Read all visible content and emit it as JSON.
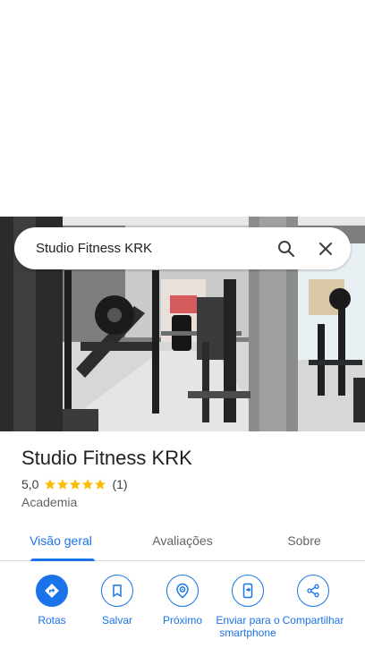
{
  "search": {
    "value": "Studio Fitness KRK",
    "search_icon": "search-icon",
    "close_icon": "close-icon"
  },
  "hero": {
    "image": "gym interior photo with weight machines"
  },
  "place": {
    "title": "Studio Fitness KRK",
    "rating": "5,0",
    "stars": 5,
    "review_count": "(1)",
    "category": "Academia",
    "star_color": "#fbbc04"
  },
  "tabs": [
    {
      "label": "Visão geral",
      "active": true
    },
    {
      "label": "Avaliações",
      "active": false
    },
    {
      "label": "Sobre",
      "active": false
    }
  ],
  "actions": [
    {
      "label": "Rotas",
      "icon": "directions-icon"
    },
    {
      "label": "Salvar",
      "icon": "bookmark-icon"
    },
    {
      "label": "Próximo",
      "icon": "nearby-icon"
    },
    {
      "label": "Enviar para o smartphone",
      "icon": "send-to-phone-icon"
    },
    {
      "label": "Compartilhar",
      "icon": "share-icon"
    }
  ],
  "colors": {
    "accent": "#1a73e8",
    "text": "#202124",
    "secondary": "#5f6368"
  }
}
